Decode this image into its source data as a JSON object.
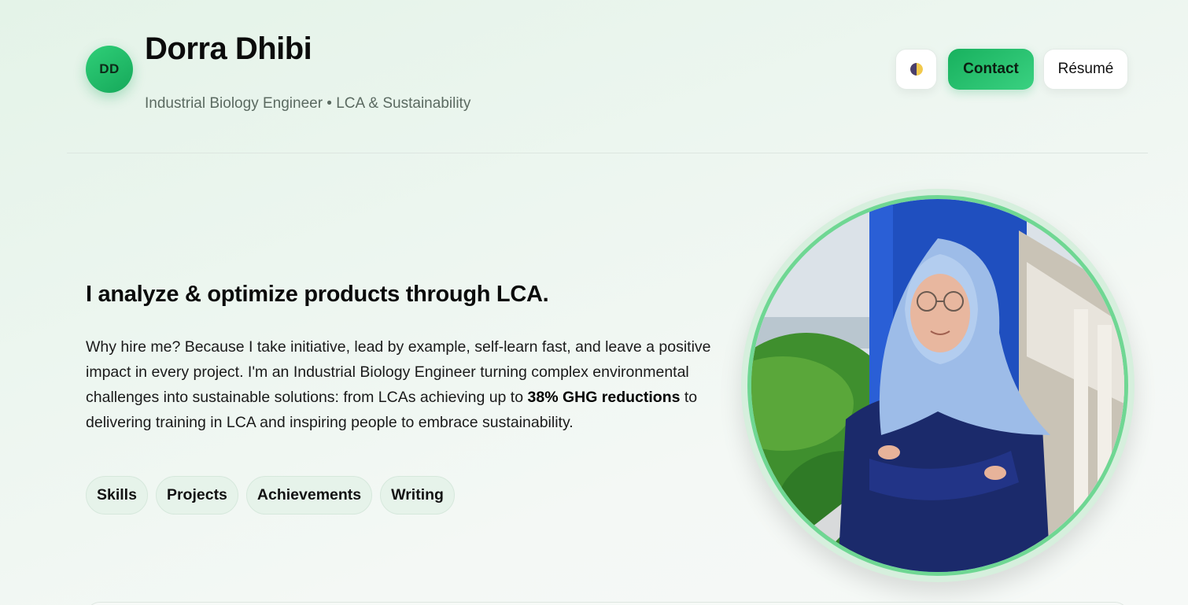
{
  "header": {
    "avatar_initials": "DD",
    "name": "Dorra Dhibi",
    "tagline": "Industrial Biology Engineer • LCA & Sustainability",
    "theme_toggle_icon": "half-moon-icon",
    "contact_label": "Contact",
    "resume_label": "Résumé"
  },
  "hero": {
    "headline": "I analyze & optimize products through LCA.",
    "bio_part1": "Why hire me? Because I take initiative, lead by example, self-learn fast, and leave a positive impact in every project. I'm an Industrial Biology Engineer turning complex environmental challenges into sustainable solutions: from LCAs achieving up to ",
    "bio_bold": "38% GHG reductions",
    "bio_part2": " to delivering training in LCA and inspiring people to embrace sustainability.",
    "chips": [
      "Skills",
      "Projects",
      "Achievements",
      "Writing"
    ]
  },
  "colors": {
    "accent": "#18b15e",
    "accent_light": "#3ad181",
    "ring": "#6fd793"
  }
}
